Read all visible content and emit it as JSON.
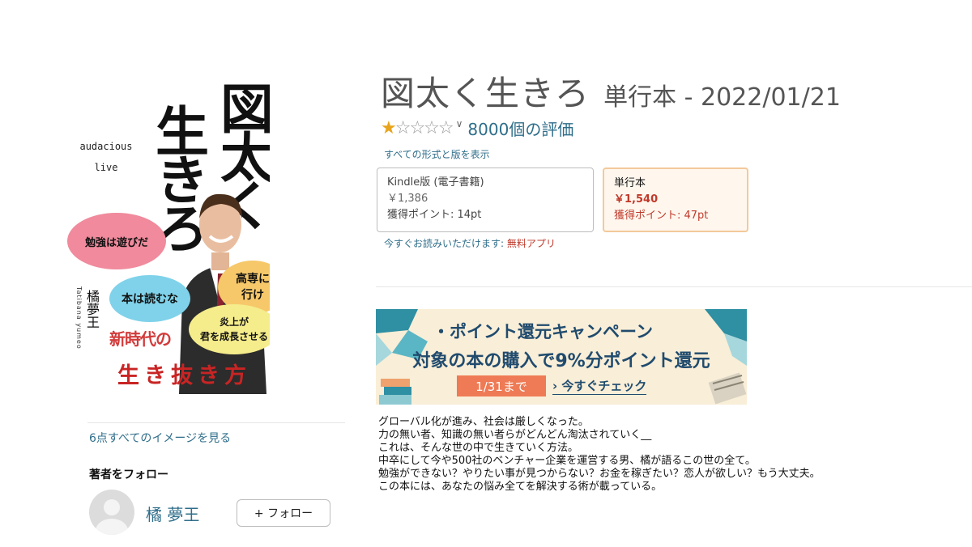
{
  "cover": {
    "title_col1": "図太く",
    "title_col2": "生きろ",
    "english_line1": "audacious",
    "english_line2": "live",
    "bubble1": "勉強は遊びだ",
    "bubble2": "本は読むな",
    "bubble3_line1": "高専に",
    "bubble3_line2": "行け",
    "bubble4_line1": "炎上が",
    "bubble4_line2": "君を成長させる",
    "author": "橘夢王",
    "author_ruby": "Tatibana yumeo",
    "subtitle": "新時代の",
    "subtitle2": "生き抜き方"
  },
  "left_panel": {
    "see_images": "6点すべてのイメージを見る",
    "follow_heading": "著者をフォロー",
    "author_name": "橘 夢王",
    "follow_button": "+ フォロー"
  },
  "product": {
    "title": "図太く生きろ",
    "format_date": "単行本 - 2022/01/21",
    "rating_stars": 1,
    "rating_count": "8000個の評価",
    "all_formats": "すべての形式と版を表示",
    "formats": [
      {
        "name": "Kindle版 (電子書籍)",
        "price": "￥1,386",
        "points": "獲得ポイント: 14pt"
      },
      {
        "name": "単行本",
        "price": "￥1,540",
        "points": "獲得ポイント: 47pt"
      }
    ],
    "read_now_prefix": "今すぐお読みいただけます: ",
    "read_now_app": "無料アプリ"
  },
  "banner": {
    "line1": "・ポイント還元キャンペーン",
    "line2": "対象の本の購入で9%分ポイント還元",
    "date": "1/31まで",
    "cta": "› 今すぐチェック"
  },
  "description": [
    "グローバル化が進み、社会は厳しくなった。",
    "力の無い者、知識の無い者らがどんどん淘汰されていく__",
    "これは、そんな世の中で生きていく方法。",
    "中卒にして今や500社のベンチャー企業を運営する男、橘が語るこの世の全て。",
    "勉強ができない？やりたい事が見つからない？お金を稼ぎたい？恋人が欲しい？もう大丈夫。",
    "この本には、あなたの悩み全てを解決する術が載っている。"
  ],
  "colors": {
    "link": "#2f6e8a",
    "star": "#e8a41b",
    "price_red": "#c0392b",
    "banner_navy": "#204b6e",
    "banner_bg": "#f9eed7",
    "banner_date_bg": "#ee7b55"
  }
}
